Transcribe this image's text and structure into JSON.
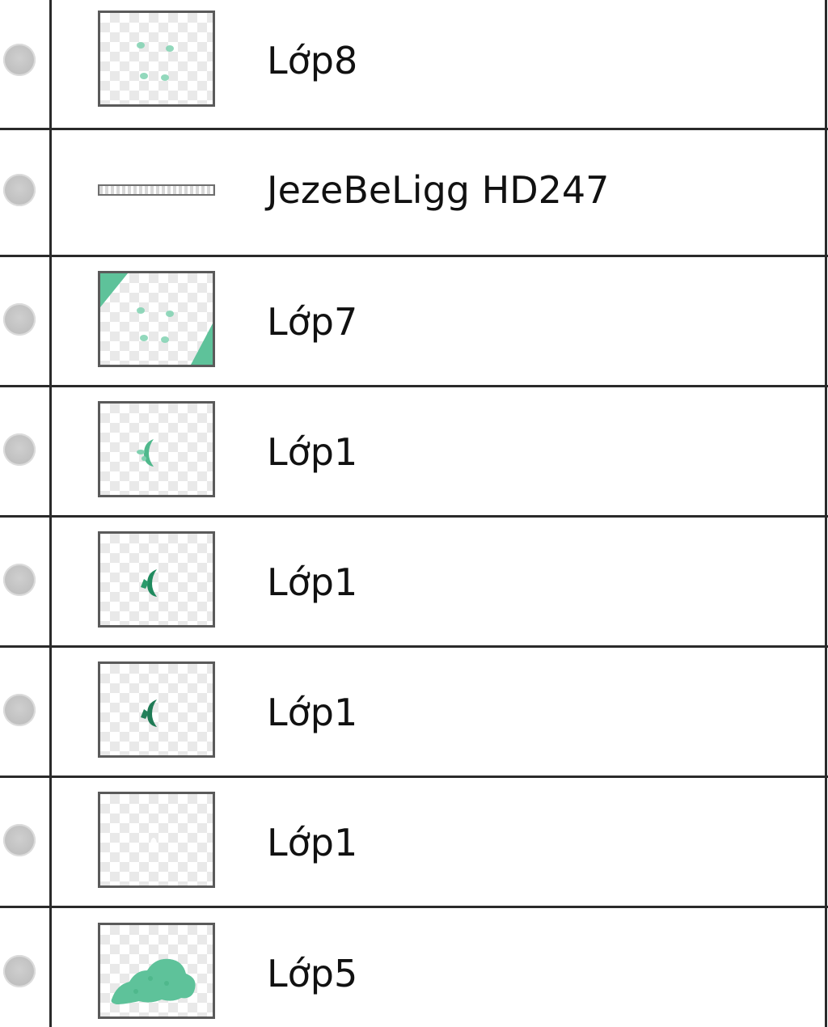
{
  "layers_panel": {
    "layers": [
      {
        "name": "Lớp8",
        "kind": "image",
        "thumbnail": "dots"
      },
      {
        "name": "JezeBeLigg HD247",
        "kind": "line",
        "thumbnail": "line-segment"
      },
      {
        "name": "Lớp7",
        "kind": "image",
        "thumbnail": "dots-with-corners"
      },
      {
        "name": "Lớp1",
        "kind": "image",
        "thumbnail": "small-shape-light"
      },
      {
        "name": "Lớp1",
        "kind": "image",
        "thumbnail": "small-shape-dark"
      },
      {
        "name": "Lớp1",
        "kind": "image",
        "thumbnail": "small-shape-dark"
      },
      {
        "name": "Lớp1",
        "kind": "image",
        "thumbnail": "empty"
      },
      {
        "name": "Lớp5",
        "kind": "image",
        "thumbnail": "green-blob"
      }
    ],
    "colors": {
      "thumbnail_green": "#5ec29a",
      "thumbnail_dark_green": "#1f8a5e",
      "divider": "#2a2a2a",
      "visibility_dot": "#c4c4c4"
    },
    "icons": {
      "visibility": "visibility-dot-icon",
      "line_layer": "line-segment-icon"
    }
  }
}
